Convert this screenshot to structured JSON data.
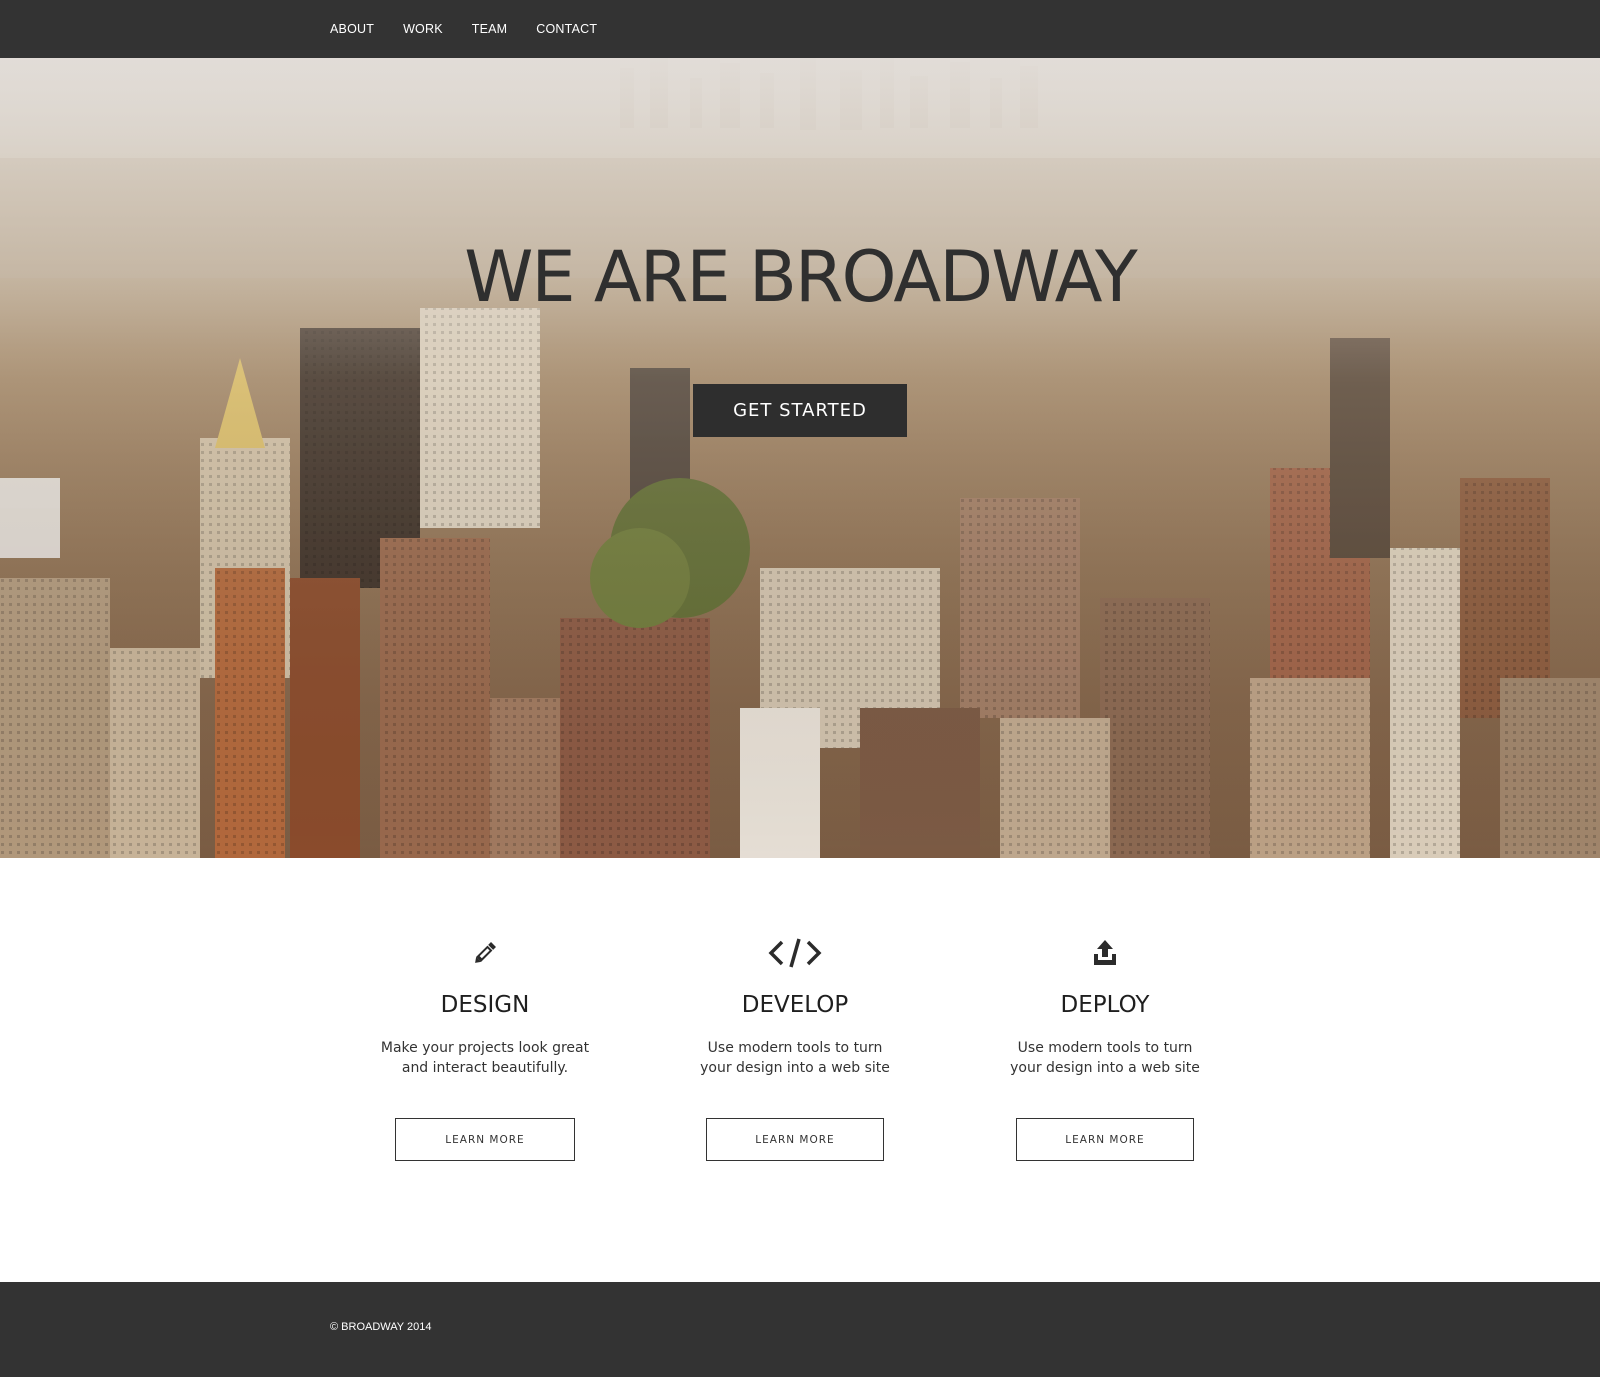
{
  "nav": {
    "items": [
      {
        "label": "ABOUT"
      },
      {
        "label": "WORK"
      },
      {
        "label": "TEAM"
      },
      {
        "label": "CONTACT"
      }
    ]
  },
  "hero": {
    "title": "WE ARE BROADWAY",
    "cta_label": "GET STARTED",
    "background": "aerial-city-photo"
  },
  "services": [
    {
      "icon": "pencil-icon",
      "title": "DESIGN",
      "description": "Make your projects look great and interact beautifully.",
      "button_label": "LEARN MORE"
    },
    {
      "icon": "code-icon",
      "title": "DEVELOP",
      "description": "Use modern tools to turn your design into a web site",
      "button_label": "LEARN MORE"
    },
    {
      "icon": "upload-icon",
      "title": "DEPLOY",
      "description": "Use modern tools to turn your design into a web site",
      "button_label": "LEARN MORE"
    }
  ],
  "footer": {
    "copyright": "© BROADWAY 2014"
  },
  "colors": {
    "nav_bg": "#333333",
    "footer_bg": "#333333",
    "button_dark": "#2e2e2e",
    "text_dark": "#1f1f1f"
  }
}
